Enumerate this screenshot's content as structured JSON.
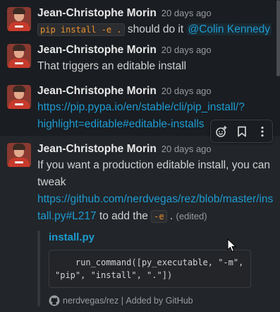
{
  "messages": [
    {
      "author": "Jean-Christophe Morin",
      "time": "20 days ago",
      "code": "pip install -e .",
      "text_after_code": " should do it ",
      "mention": "@Colin Kennedy"
    },
    {
      "author": "Jean-Christophe Morin",
      "time": "20 days ago",
      "text": "That triggers an editable install"
    },
    {
      "author": "Jean-Christophe Morin",
      "time": "20 days ago",
      "link_line1": "https://pip.pypa.io/en/stable/cli/pip_install/?",
      "link_line2": "highlight=editable#editable-installs"
    },
    {
      "author": "Jean-Christophe Morin",
      "time": "20 days ago",
      "text_line1": "If you want a production editable install, you can",
      "text_line2": "tweak",
      "link_line1": "https://github.com/nerdvegas/rez/blob/master/ins",
      "link_line2": "tall.py#L217",
      "text_after_link": " to add the ",
      "code": "-e",
      "text_after_code": " . ",
      "edited": "(edited)",
      "unfurl": {
        "title": "install.py",
        "code_line1": "    run_command([py_executable, \"-m\",",
        "code_line2": "\"pip\", \"install\", \".\"])",
        "source": "nerdvegas/rez",
        "separator": " | ",
        "added_by": "Added by GitHub"
      }
    }
  ],
  "toolbar": {
    "icons": [
      "add-reaction-icon",
      "bookmark-icon",
      "more-actions-icon"
    ]
  },
  "colors": {
    "background": "#1a1d21",
    "link": "#1d9bd1",
    "code_text": "#e8912d"
  }
}
